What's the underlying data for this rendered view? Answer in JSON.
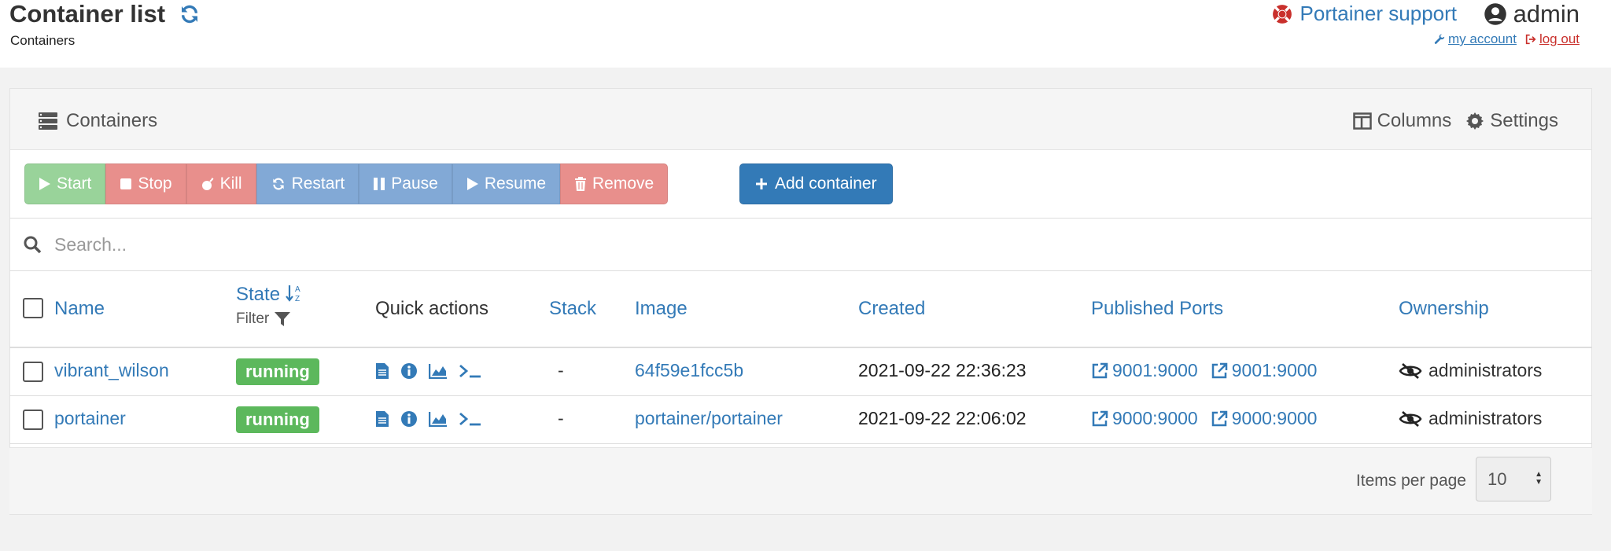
{
  "header": {
    "title": "Container list",
    "subtitle": "Containers",
    "support_label": "Portainer support",
    "username": "admin",
    "my_account": "my account",
    "log_out": "log out"
  },
  "widget": {
    "title": "Containers",
    "columns_label": "Columns",
    "settings_label": "Settings"
  },
  "actions": {
    "start": "Start",
    "stop": "Stop",
    "kill": "Kill",
    "restart": "Restart",
    "pause": "Pause",
    "resume": "Resume",
    "remove": "Remove",
    "add": "Add container"
  },
  "search": {
    "placeholder": "Search..."
  },
  "table": {
    "columns": {
      "name": "Name",
      "state": "State",
      "state_filter": "Filter",
      "quick_actions": "Quick actions",
      "stack": "Stack",
      "image": "Image",
      "created": "Created",
      "ports": "Published Ports",
      "ownership": "Ownership"
    },
    "rows": [
      {
        "name": "vibrant_wilson",
        "state": "running",
        "stack": "-",
        "image": "64f59e1fcc5b",
        "created": "2021-09-22 22:36:23",
        "ports": [
          "9001:9000",
          "9001:9000"
        ],
        "ownership": "administrators"
      },
      {
        "name": "portainer",
        "state": "running",
        "stack": "-",
        "image": "portainer/portainer",
        "created": "2021-09-22 22:06:02",
        "ports": [
          "9000:9000",
          "9000:9000"
        ],
        "ownership": "administrators"
      }
    ]
  },
  "footer": {
    "items_per_page_label": "Items per page",
    "items_per_page_value": "10"
  },
  "colors": {
    "primary": "#337ab7",
    "success": "#5cb85c",
    "danger": "#e88f8c",
    "info": "#82a9d6",
    "start": "#99d39a"
  }
}
